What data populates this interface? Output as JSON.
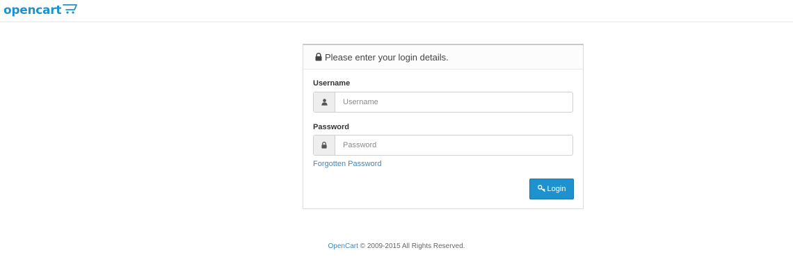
{
  "header": {
    "logo_text": "opencart",
    "brand_color": "#1e91cf"
  },
  "panel": {
    "heading": "Please enter your login details.",
    "heading_icon": "lock-icon",
    "username": {
      "label": "Username",
      "placeholder": "Username",
      "value": "",
      "icon": "user-icon"
    },
    "password": {
      "label": "Password",
      "placeholder": "Password",
      "value": "",
      "icon": "lock-icon"
    },
    "forgot_link": "Forgotten Password",
    "login_button": {
      "label": "Login",
      "icon": "key-icon"
    }
  },
  "footer": {
    "link_text": "OpenCart",
    "rest": " © 2009-2015 All Rights Reserved."
  }
}
